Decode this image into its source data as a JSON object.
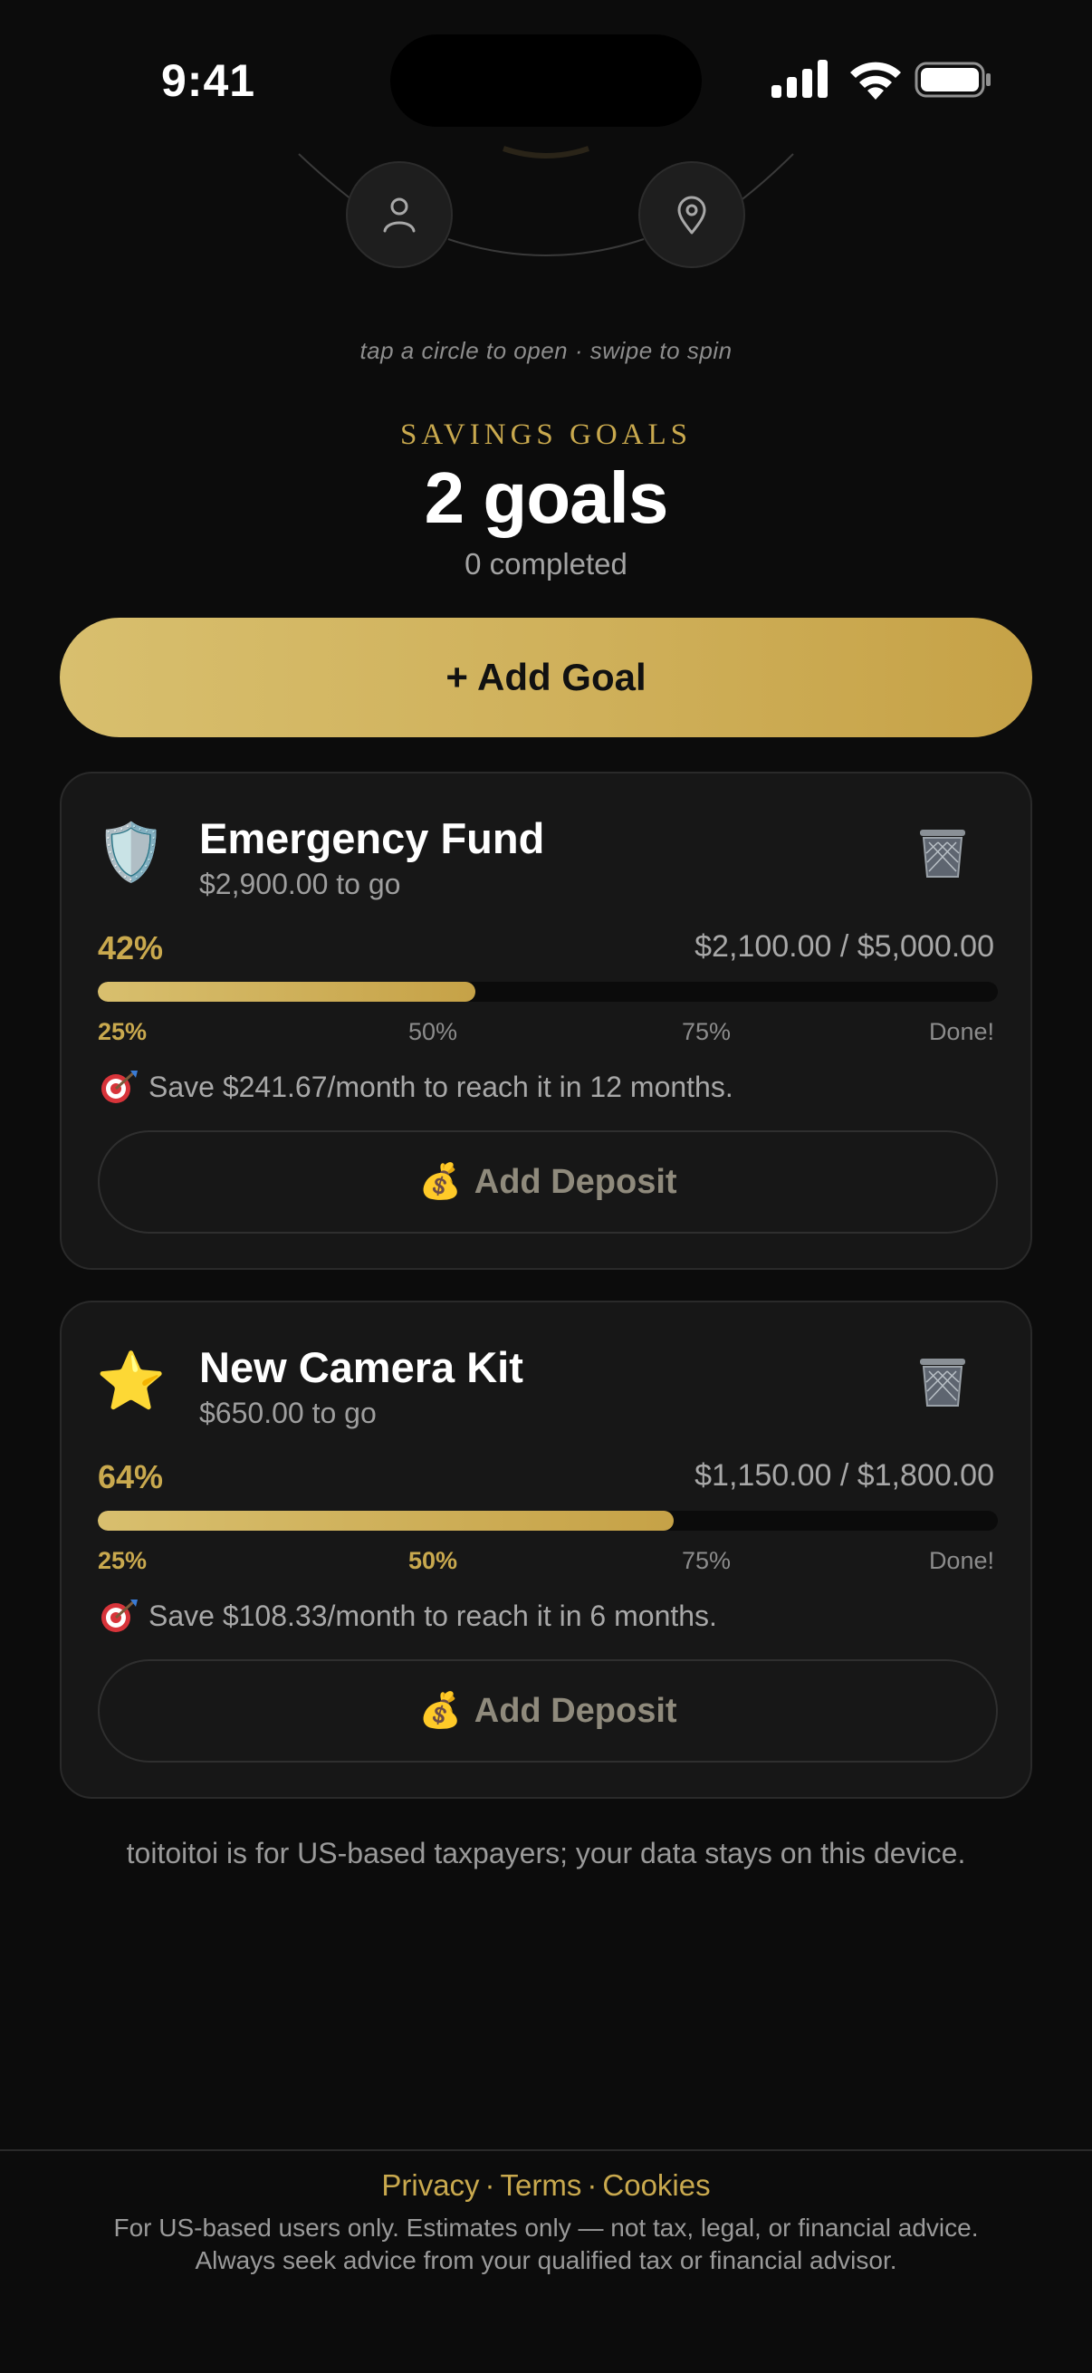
{
  "status_bar": {
    "time": "9:41"
  },
  "wheel": {
    "hint": "tap a circle to open · swipe to spin"
  },
  "header": {
    "eyebrow": "SAVINGS GOALS",
    "count": "2 goals",
    "completed": "0 completed"
  },
  "add_goal": {
    "label": "+ Add Goal"
  },
  "goals": [
    {
      "emoji": "🛡️",
      "title": "Emergency Fund",
      "remaining": "$2,900.00 to go",
      "percent_label": "42%",
      "progress": 0.42,
      "amounts": "$2,100.00 / $5,000.00",
      "milestones": [
        "25%",
        "50%",
        "75%",
        "Done!"
      ],
      "plan": "Save $241.67/month to reach it in 12 months.",
      "deposit_label": "Add Deposit"
    },
    {
      "emoji": "⭐",
      "title": "New Camera Kit",
      "remaining": "$650.00 to go",
      "percent_label": "64%",
      "progress": 0.64,
      "amounts": "$1,150.00 / $1,800.00",
      "milestones": [
        "25%",
        "50%",
        "75%",
        "Done!"
      ],
      "plan": "Save $108.33/month to reach it in 6 months.",
      "deposit_label": "Add Deposit"
    }
  ],
  "note": "toitoitoi is for US-based taxpayers; your data stays on this device.",
  "footer": {
    "links": [
      "Privacy",
      "Terms",
      "Cookies"
    ],
    "separator": "·",
    "line1": "For US-based users only. Estimates only — not tax, legal, or financial advice.",
    "line2": "Always seek advice from your qualified tax or financial advisor."
  },
  "colors": {
    "accent": "#c9a94e",
    "background": "#0c0c0c",
    "card": "#171717"
  },
  "icons": [
    "person-icon",
    "location-pin-icon",
    "trash-icon",
    "target-icon",
    "money-bag-icon"
  ]
}
